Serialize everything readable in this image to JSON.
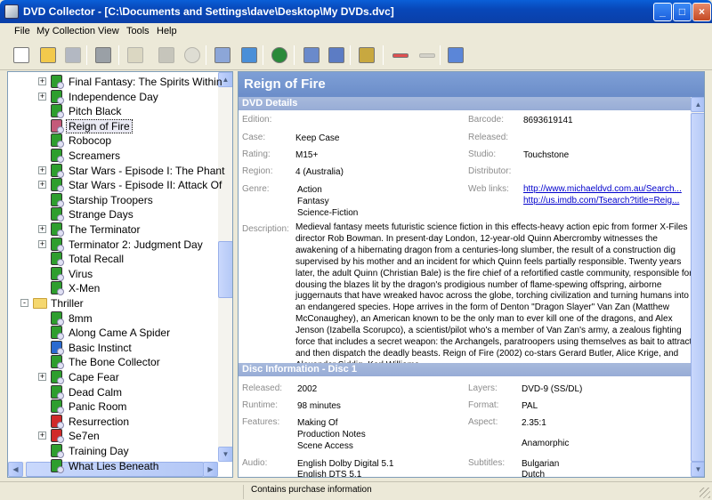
{
  "window": {
    "title": "DVD Collector - [C:\\Documents and Settings\\dave\\Desktop\\My DVDs.dvc]",
    "min_glyph": "_",
    "max_glyph": "□",
    "close_glyph": "×"
  },
  "menu": [
    "File",
    "My Collection",
    "View",
    "Tools",
    "Help"
  ],
  "toolbar": [
    {
      "name": "new-icon",
      "color": "#ffffff",
      "disabled": false
    },
    {
      "name": "open-folder-icon",
      "color": "#f2c94c",
      "disabled": false
    },
    {
      "name": "save-icon",
      "color": "#6f7fa8",
      "disabled": true
    },
    {
      "name": "print-icon",
      "color": "#9aa0a6",
      "disabled": false
    },
    {
      "name": "open-disc-folder-icon",
      "color": "#c8c2a8",
      "disabled": true
    },
    {
      "name": "box-icon",
      "color": "#9a9a9a",
      "disabled": true
    },
    {
      "name": "disc-icon",
      "color": "#cfcfcf",
      "disabled": true
    },
    {
      "name": "edit-icon",
      "color": "#8ca6d8",
      "disabled": false
    },
    {
      "name": "import-icon",
      "color": "#4a8fd8",
      "disabled": false
    },
    {
      "name": "web-icon",
      "color": "#2a8a3a",
      "disabled": false
    },
    {
      "name": "list-view-icon",
      "color": "#6a8acb",
      "disabled": false
    },
    {
      "name": "chart-icon",
      "color": "#5c7cc4",
      "disabled": false
    },
    {
      "name": "binoculars-icon",
      "color": "#c8a840",
      "disabled": false
    },
    {
      "name": "remove-icon",
      "color": "#e05050",
      "disabled": false
    },
    {
      "name": "add-icon",
      "color": "#b8b8b8",
      "disabled": true
    },
    {
      "name": "card-icon",
      "color": "#5b86d8",
      "disabled": false
    }
  ],
  "tree": {
    "items": [
      {
        "label": "Final Fantasy: The Spirits Within",
        "level": 2,
        "expander": "+",
        "icon": "#2e9e2e"
      },
      {
        "label": "Independence Day",
        "level": 2,
        "expander": "+",
        "icon": "#2e9e2e"
      },
      {
        "label": "Pitch Black",
        "level": 2,
        "expander": "",
        "icon": "#2e9e2e"
      },
      {
        "label": "Reign of Fire",
        "level": 2,
        "expander": "",
        "icon": "#c45a7a",
        "selected": true
      },
      {
        "label": "Robocop",
        "level": 2,
        "expander": "",
        "icon": "#2e9e2e"
      },
      {
        "label": "Screamers",
        "level": 2,
        "expander": "",
        "icon": "#2e9e2e"
      },
      {
        "label": "Star Wars - Episode I: The Phant",
        "level": 2,
        "expander": "+",
        "icon": "#2e9e2e"
      },
      {
        "label": "Star Wars - Episode II: Attack Of",
        "level": 2,
        "expander": "+",
        "icon": "#2e9e2e"
      },
      {
        "label": "Starship Troopers",
        "level": 2,
        "expander": "",
        "icon": "#2e9e2e"
      },
      {
        "label": "Strange Days",
        "level": 2,
        "expander": "",
        "icon": "#2e9e2e"
      },
      {
        "label": "The Terminator",
        "level": 2,
        "expander": "+",
        "icon": "#2e9e2e"
      },
      {
        "label": "Terminator 2: Judgment Day",
        "level": 2,
        "expander": "+",
        "icon": "#2e9e2e"
      },
      {
        "label": "Total Recall",
        "level": 2,
        "expander": "",
        "icon": "#2e9e2e"
      },
      {
        "label": "Virus",
        "level": 2,
        "expander": "",
        "icon": "#2e9e2e"
      },
      {
        "label": "X-Men",
        "level": 2,
        "expander": "",
        "icon": "#2e9e2e"
      },
      {
        "label": "Thriller",
        "level": 1,
        "expander": "-",
        "icon": "folder"
      },
      {
        "label": "8mm",
        "level": 2,
        "expander": "",
        "icon": "#2e9e2e"
      },
      {
        "label": "Along Came A Spider",
        "level": 2,
        "expander": "",
        "icon": "#2e9e2e"
      },
      {
        "label": "Basic Instinct",
        "level": 2,
        "expander": "",
        "icon": "#2a6ad0"
      },
      {
        "label": "The Bone Collector",
        "level": 2,
        "expander": "",
        "icon": "#2e9e2e"
      },
      {
        "label": "Cape Fear",
        "level": 2,
        "expander": "+",
        "icon": "#2e9e2e"
      },
      {
        "label": "Dead Calm",
        "level": 2,
        "expander": "",
        "icon": "#2e9e2e"
      },
      {
        "label": "Panic Room",
        "level": 2,
        "expander": "",
        "icon": "#2e9e2e"
      },
      {
        "label": "Resurrection",
        "level": 2,
        "expander": "",
        "icon": "#d02a2a"
      },
      {
        "label": "Se7en",
        "level": 2,
        "expander": "+",
        "icon": "#d02a2a"
      },
      {
        "label": "Training Day",
        "level": 2,
        "expander": "",
        "icon": "#2e9e2e"
      },
      {
        "label": "What Lies Beneath",
        "level": 2,
        "expander": "",
        "icon": "#2e9e2e"
      }
    ]
  },
  "detail": {
    "title": "Reign of Fire",
    "dvd_section": "DVD Details",
    "disc_section": "Disc Information - Disc 1",
    "left_fields": [
      {
        "label": "Edition:",
        "value": ""
      },
      {
        "label": "Case:",
        "value": "Keep Case"
      },
      {
        "label": "Rating:",
        "value": "M15+"
      },
      {
        "label": "Region:",
        "value": "4 (Australia)"
      }
    ],
    "genre_label": "Genre:",
    "genres": [
      "Action",
      "Fantasy",
      "Science-Fiction"
    ],
    "right_fields": [
      {
        "label": "Barcode:",
        "value": "8693619141"
      },
      {
        "label": "Released:",
        "value": ""
      },
      {
        "label": "Studio:",
        "value": "Touchstone"
      },
      {
        "label": "Distributor:",
        "value": ""
      }
    ],
    "web_links_label": "Web links:",
    "web_links": [
      "http://www.michaeldvd.com.au/Search...",
      "http://us.imdb.com/Tsearch?title=Reig..."
    ],
    "description_label": "Description:",
    "description": "Medieval fantasy meets futuristic science fiction in this effects-heavy action epic from former X-Files director Rob Bowman. In present-day London, 12-year-old Quinn Abercromby witnesses the awakening of a hibernating dragon from a centuries-long slumber, the result of a construction dig supervised by his mother and an incident for which Quinn feels partially responsible. Twenty years later, the adult Quinn (Christian Bale) is the fire chief of a refortified castle community, responsible for dousing the blazes lit by the dragon's prodigious number of flame-spewing offspring, airborne juggernauts that have wreaked havoc across the globe, torching civilization and turning humans into an endangered species. Hope arrives in the form of Denton \"Dragon Slayer\" Van Zan (Matthew McConaughey), an American known to be the only man to ever kill one of the dragons, and Alex Jenson (Izabella Scorupco), a scientist/pilot who's a member of Van Zan's army, a zealous fighting force that includes a secret weapon: the Archangels, paratroopers using themselves as bait to attract and then dispatch the deadly beasts. Reign of Fire (2002) co-stars Gerard Butler, Alice Krige, and Alexander Siddig. Karl Williams",
    "disc": {
      "released_label": "Released:",
      "released": "2002",
      "runtime_label": "Runtime:",
      "runtime": "98 minutes",
      "features_label": "Features:",
      "features": [
        "Making Of",
        "Production Notes",
        "Scene Access"
      ],
      "audio_label": "Audio:",
      "audio": [
        "English Dolby Digital 5.1",
        "English DTS 5.1"
      ],
      "layers_label": "Layers:",
      "layers": "DVD-9 (SS/DL)",
      "format_label": "Format:",
      "format": "PAL",
      "aspect_label": "Aspect:",
      "aspect": "2.35:1",
      "aspect_extra": "Anamorphic",
      "subtitles_label": "Subtitles:",
      "subtitles": [
        "Bulgarian",
        "Dutch"
      ]
    }
  },
  "status": {
    "message": "Contains purchase information"
  },
  "colors": {
    "header_blue": "#7e9fd6",
    "section_blue": "#a7b9dc",
    "link": "#0000cc"
  }
}
